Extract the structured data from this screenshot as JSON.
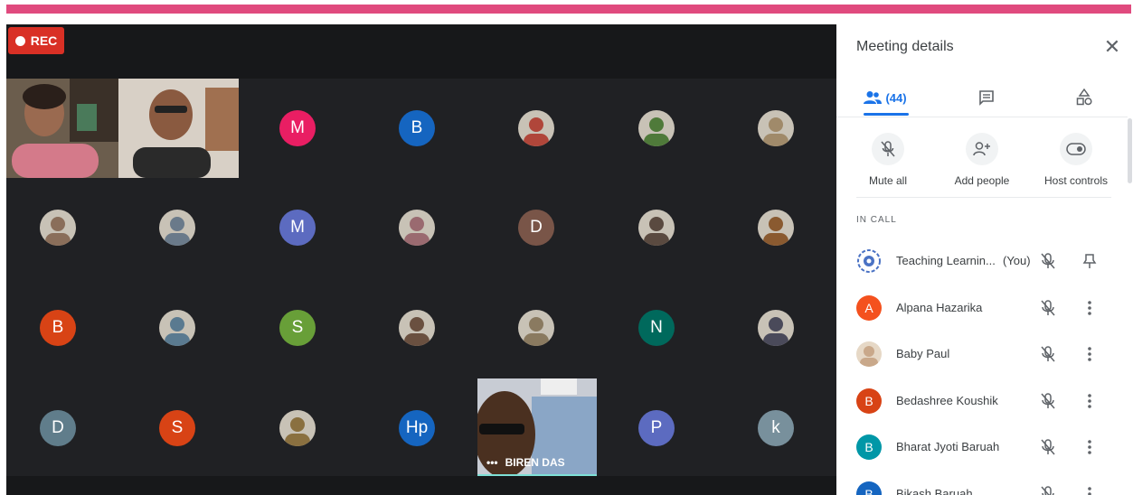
{
  "recording": {
    "label": "REC"
  },
  "grid": {
    "video_left": {
      "desc": "two-person video"
    },
    "tiles": [
      {
        "type": "letter",
        "letter": "M",
        "color": "#e91e63"
      },
      {
        "type": "letter",
        "letter": "B",
        "color": "#1565c0"
      },
      {
        "type": "photo",
        "color": "#b0463a"
      },
      {
        "type": "photo",
        "color": "#4f7a3a"
      },
      {
        "type": "photo",
        "color": "#a08a6a"
      },
      {
        "type": "photo",
        "color": "#8a6e5a"
      },
      {
        "type": "photo",
        "color": "#6a7a8a"
      },
      {
        "type": "letter",
        "letter": "M",
        "color": "#5c6bc0"
      },
      {
        "type": "photo",
        "color": "#9a6a70"
      },
      {
        "type": "letter",
        "letter": "D",
        "color": "#795548"
      },
      {
        "type": "photo",
        "color": "#5a4a40"
      },
      {
        "type": "photo",
        "color": "#8a5a30"
      },
      {
        "type": "letter",
        "letter": "B",
        "color": "#d84315"
      },
      {
        "type": "photo",
        "color": "#5a7a90"
      },
      {
        "type": "letter",
        "letter": "S",
        "color": "#689f38"
      },
      {
        "type": "photo",
        "color": "#6a5040"
      },
      {
        "type": "photo",
        "color": "#8a7a60"
      },
      {
        "type": "letter",
        "letter": "N",
        "color": "#00695c"
      },
      {
        "type": "photo",
        "color": "#4a4a5a"
      },
      {
        "type": "letter",
        "letter": "D",
        "color": "#607d8b"
      },
      {
        "type": "letter",
        "letter": "S",
        "color": "#d84315"
      },
      {
        "type": "photo",
        "color": "#8a7040"
      },
      {
        "type": "letter",
        "letter": "Hp",
        "color": "#1565c0"
      },
      {
        "type": "video",
        "name": "BIREN DAS"
      },
      {
        "type": "letter",
        "letter": "P",
        "color": "#5c6bc0"
      },
      {
        "type": "letter",
        "letter": "k",
        "color": "#78909c"
      }
    ]
  },
  "panel": {
    "title": "Meeting details",
    "tabs": {
      "people_count": "(44)"
    },
    "actions": [
      {
        "label": "Mute all"
      },
      {
        "label": "Add people"
      },
      {
        "label": "Host controls"
      }
    ],
    "section_label": "IN CALL",
    "participants": [
      {
        "name": "Teaching Learnin...",
        "tag": "(You)",
        "avatar": "logo",
        "color": "#1a73e8"
      },
      {
        "name": "Alpana Hazarika",
        "initial": "A",
        "color": "#f4511e"
      },
      {
        "name": "Baby Paul",
        "avatar": "photo",
        "color": "#c9a88a"
      },
      {
        "name": "Bedashree Koushik",
        "initial": "B",
        "color": "#d84315"
      },
      {
        "name": "Bharat Jyoti Baruah",
        "initial": "B",
        "color": "#0097a7"
      },
      {
        "name": "Bikash Baruah",
        "initial": "B",
        "color": "#1565c0"
      }
    ]
  },
  "colors": {
    "accent": "#1a73e8",
    "rec": "#d93025",
    "stage": "#202124",
    "top_bar": "#e04a7e"
  }
}
